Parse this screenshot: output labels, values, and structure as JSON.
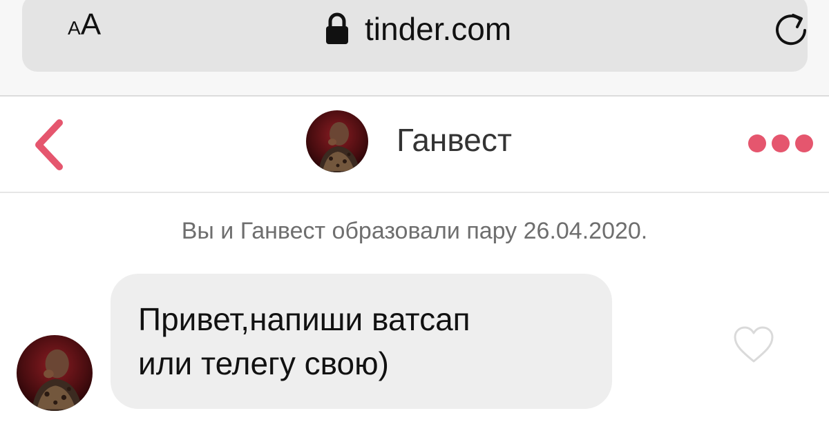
{
  "browser": {
    "text_size_small": "A",
    "text_size_big": "A",
    "url": "tinder.com",
    "icons": [
      "text-size-icon",
      "lock-icon",
      "reload-icon"
    ]
  },
  "chat_header": {
    "name": "Ганвест",
    "icons": [
      "back-chevron-icon",
      "more-dots-icon"
    ],
    "accent_color": "#e5566e"
  },
  "conversation": {
    "match_note": "Вы и Ганвест образовали пару 26.04.2020.",
    "messages": [
      {
        "lines": [
          "Привет,напиши ватсап",
          "или телегу свою)"
        ],
        "liked": false
      }
    ]
  }
}
